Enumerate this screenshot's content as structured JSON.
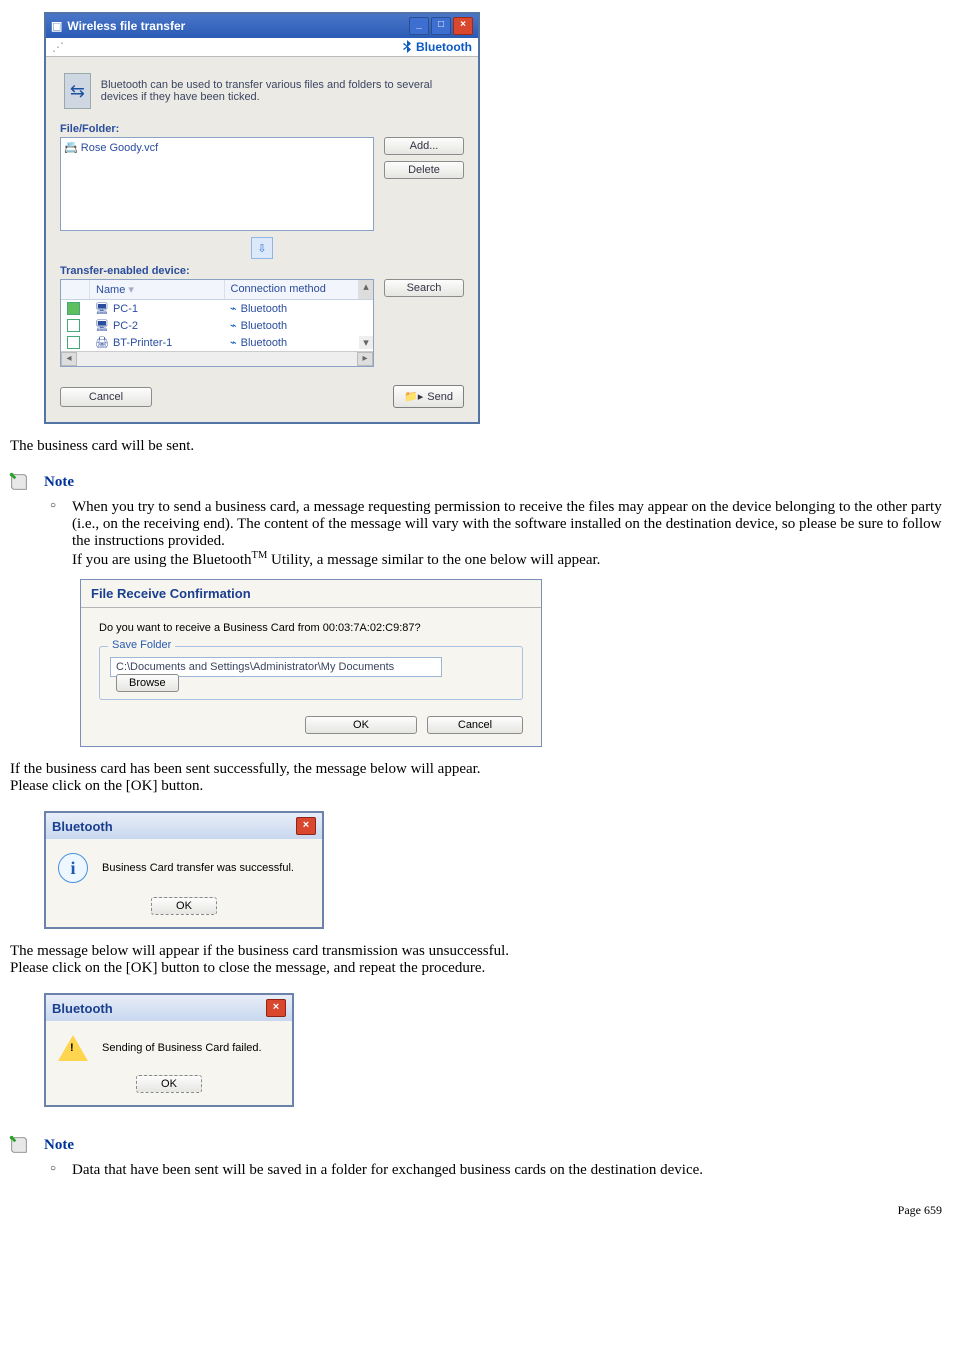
{
  "wft": {
    "title": "Wireless file transfer",
    "brand": "Bluetooth",
    "intro": "Bluetooth can be used to transfer various files and folders to several devices if they have been ticked.",
    "file_folder_label": "File/Folder:",
    "file_item": "Rose Goody.vcf",
    "add_btn": "Add...",
    "delete_btn": "Delete",
    "device_label": "Transfer-enabled device:",
    "cols": {
      "name": "Name",
      "conn": "Connection method"
    },
    "devices": [
      {
        "checked": true,
        "name": "PC-1",
        "conn": "Bluetooth"
      },
      {
        "checked": false,
        "name": "PC-2",
        "conn": "Bluetooth"
      },
      {
        "checked": false,
        "name": "BT-Printer-1",
        "conn": "Bluetooth"
      }
    ],
    "search_btn": "Search",
    "cancel_btn": "Cancel",
    "send_btn": "Send"
  },
  "body1": "The business card will be sent.",
  "note_label": "Note",
  "note1_text": "When you try to send a business card, a message requesting permission to receive the files may appear on the device belonging to the other party (i.e., on the receiving end). The content of the message will vary with the software installed on the destination device, so please be sure to follow the instructions provided.",
  "note1_text2a": "If you are using the Bluetooth",
  "note1_text2b": " Utility, a message similar to the one below will appear.",
  "frc": {
    "title": "File Receive Confirmation",
    "question": "Do you want to receive a Business Card from 00:03:7A:02:C9:87?",
    "legend": "Save Folder",
    "path": "C:\\Documents and Settings\\Administrator\\My Documents",
    "browse": "Browse",
    "ok": "OK",
    "cancel": "Cancel"
  },
  "body2a": "If the business card has been sent successfully, the message below will appear.",
  "body2b": "Please click on the [OK] button.",
  "msg_success": {
    "title": "Bluetooth",
    "text": "Business Card transfer was successful.",
    "ok": "OK"
  },
  "body3a": "The message below will appear if the business card transmission was unsuccessful.",
  "body3b": "Please click on the [OK] button to close the message, and repeat the procedure.",
  "msg_fail": {
    "title": "Bluetooth",
    "text": "Sending of Business Card failed.",
    "ok": "OK"
  },
  "note2_text": "Data that have been sent will be saved in a folder for exchanged business cards on the destination device.",
  "footer": "Page 659"
}
